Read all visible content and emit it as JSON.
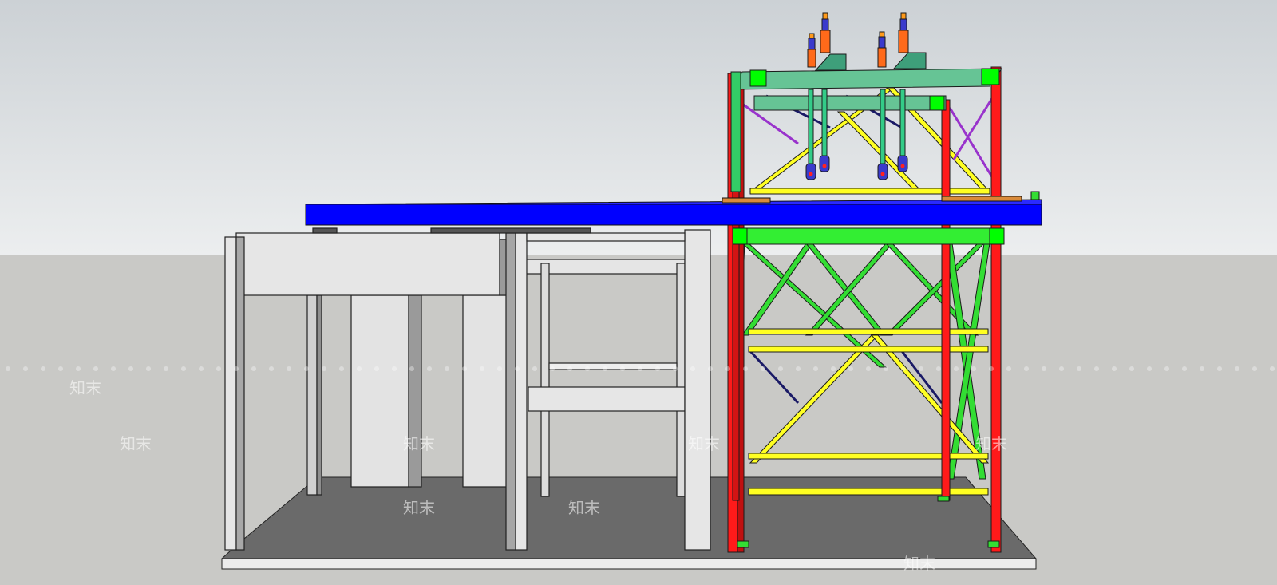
{
  "scene": {
    "sky_top_color": "#ccd1d5",
    "sky_bottom_color": "#eceeef",
    "ground_color": "#c9c9c6",
    "base_slab_color": "#6a6a6a",
    "concrete_color": "#e2e2e2",
    "beam_color": "#0000ff",
    "column_color": "#ff1a1a",
    "lower_brace_color": "#33dd33",
    "upper_brace_color": "#ffff22",
    "top_frame_color": "#66c495",
    "node_color": "#00ff00",
    "jack_color": "#ff6a1a"
  },
  "watermarks": [
    {
      "text": "知末"
    },
    {
      "text": "知末"
    },
    {
      "text": "知末"
    },
    {
      "text": "知末"
    },
    {
      "text": "知末"
    },
    {
      "text": "知末"
    },
    {
      "text": "知末"
    },
    {
      "text": "知末"
    }
  ]
}
